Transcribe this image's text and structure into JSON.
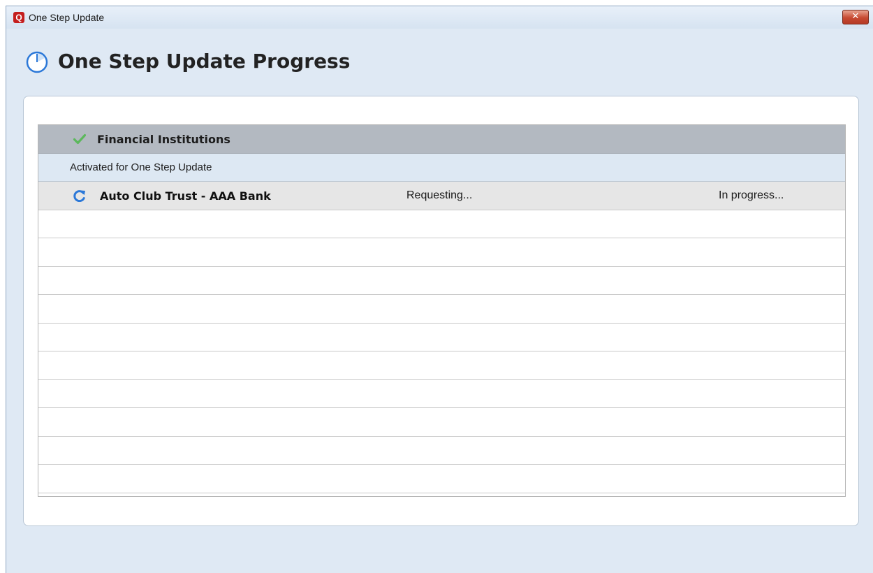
{
  "window": {
    "title": "One Step Update",
    "app_icon_letter": "Q",
    "close_symbol": "✕"
  },
  "heading": {
    "title": "One Step Update Progress",
    "icon": "clock-icon"
  },
  "group": {
    "label": "Financial Institutions",
    "icon": "checkmark-icon"
  },
  "subgroup": {
    "label": "Activated for One Step Update"
  },
  "accounts": [
    {
      "name": "Auto Club Trust - AAA Bank",
      "status": "Requesting...",
      "progress": "In progress...",
      "icon": "refresh-icon"
    }
  ],
  "colors": {
    "accent_blue": "#2b78d8",
    "check_green": "#5cb85c",
    "app_icon_red": "#c41e1e",
    "close_red": "#c74a32"
  }
}
